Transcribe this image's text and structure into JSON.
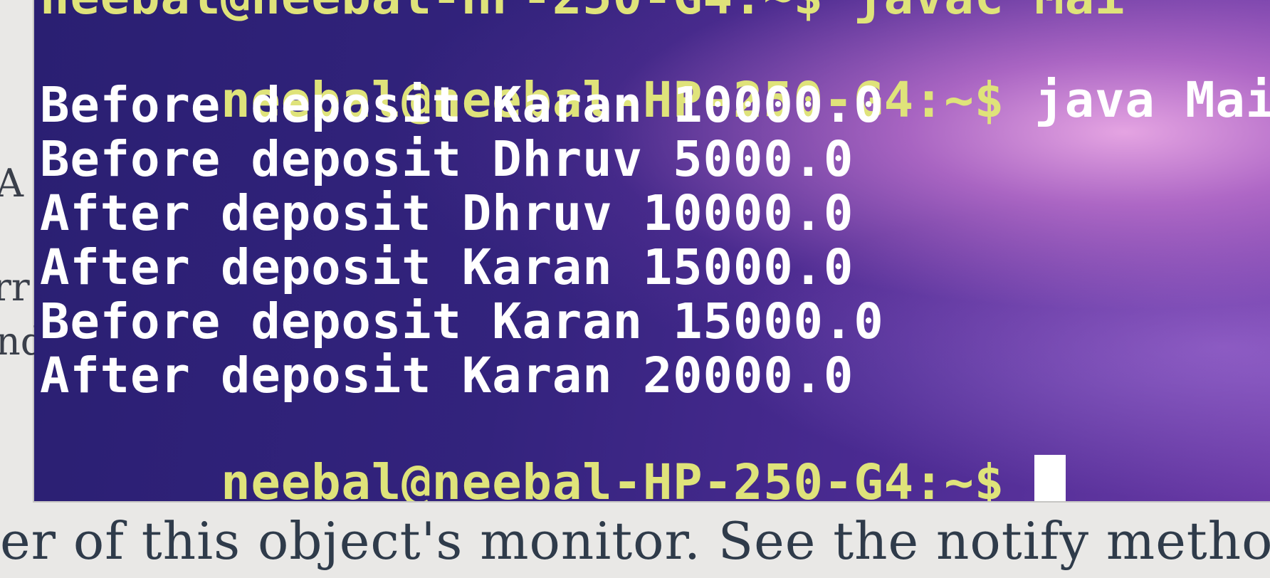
{
  "document": {
    "bottom_text": "er of this object's monitor. See the notify metho",
    "left_fragments": [
      "A",
      "rr",
      "nd"
    ]
  },
  "terminal": {
    "top_partial": "neebal@neebal-HP-250-G4:~$ javac Mai",
    "lines": [
      {
        "prompt": "neebal@neebal-HP-250-G4:~$",
        "command": " java Main"
      },
      {
        "text": "Before deposit Karan 10000.0"
      },
      {
        "text": "Before deposit Dhruv 5000.0"
      },
      {
        "text": "After deposit Dhruv 10000.0"
      },
      {
        "text": "After deposit Karan 15000.0"
      },
      {
        "text": "Before deposit Karan 15000.0"
      },
      {
        "text": "After deposit Karan 20000.0"
      }
    ],
    "final_prompt": "neebal@neebal-HP-250-G4:~$",
    "colors": {
      "prompt": "#dfe37a",
      "output": "#ffffff",
      "background": "#2f2378"
    }
  }
}
